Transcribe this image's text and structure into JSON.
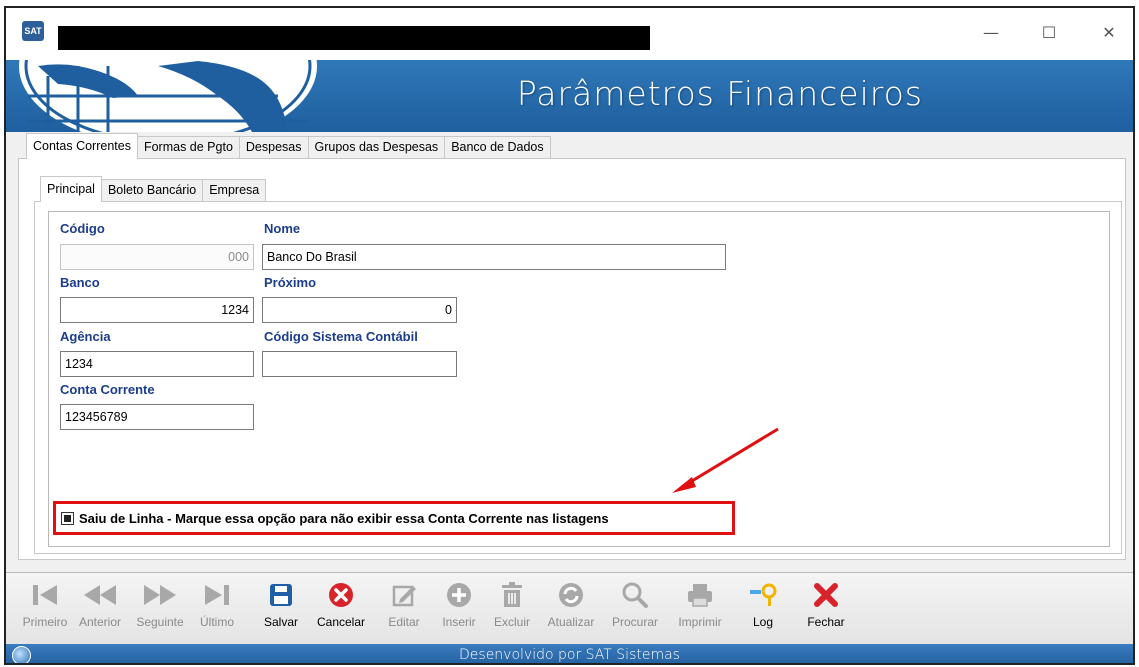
{
  "window": {
    "app_icon_text": "SAT",
    "minimize_glyph": "—",
    "maximize_glyph": "☐",
    "close_glyph": "✕"
  },
  "banner": {
    "title": "Parâmetros Financeiros"
  },
  "tabs_top": [
    {
      "label": "Contas Correntes",
      "active": true
    },
    {
      "label": "Formas de Pgto",
      "active": false
    },
    {
      "label": "Despesas",
      "active": false
    },
    {
      "label": "Grupos das Despesas",
      "active": false
    },
    {
      "label": "Banco de Dados",
      "active": false
    }
  ],
  "tabs_inner": [
    {
      "label": "Principal",
      "active": true
    },
    {
      "label": "Boleto Bancário",
      "active": false
    },
    {
      "label": "Empresa",
      "active": false
    }
  ],
  "form": {
    "codigo": {
      "label": "Código",
      "value": "000"
    },
    "nome": {
      "label": "Nome",
      "value": "Banco Do Brasil"
    },
    "banco": {
      "label": "Banco",
      "value": "1234"
    },
    "proximo": {
      "label": "Próximo",
      "value": "0"
    },
    "agencia": {
      "label": "Agência",
      "value": "1234"
    },
    "codigo_contabil": {
      "label": "Código Sistema Contábil",
      "value": ""
    },
    "conta_corrente": {
      "label": "Conta Corrente",
      "value": "123456789"
    },
    "saiu_de_linha": {
      "label": "Saiu de Linha - Marque essa opção para não exibir essa Conta Corrente nas listagens",
      "checked": true
    }
  },
  "toolbar": {
    "primeiro": "Primeiro",
    "anterior": "Anterior",
    "seguinte": "Seguinte",
    "ultimo": "Último",
    "salvar": "Salvar",
    "cancelar": "Cancelar",
    "editar": "Editar",
    "inserir": "Inserir",
    "excluir": "Excluir",
    "atualizar": "Atualizar",
    "procurar": "Procurar",
    "imprimir": "Imprimir",
    "log": "Log",
    "fechar": "Fechar"
  },
  "status": {
    "text": "Desenvolvido por SAT Sistemas"
  },
  "colors": {
    "banner_blue": "#2f78b8",
    "label_blue": "#1c3d8c",
    "highlight_red": "#e01010",
    "save_icon_blue": "#1f5fa8",
    "cancel_icon_red": "#d9232a"
  }
}
